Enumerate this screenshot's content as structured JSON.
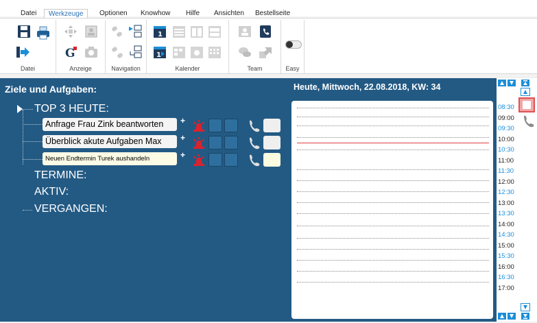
{
  "menu": {
    "tabs": [
      "Datei",
      "Werkzeuge",
      "Optionen",
      "Knowhow",
      "Hilfe",
      "Ansichten",
      "Bestellseite"
    ],
    "active": "Werkzeuge"
  },
  "ribbon": {
    "groups": [
      "Datei",
      "Anzeige",
      "Navigation",
      "Kalender",
      "Team",
      "Easy"
    ]
  },
  "left": {
    "title": "Ziele und Aufgaben:",
    "sections": {
      "top3": "TOP 3 HEUTE:",
      "termine": "TERMINE:",
      "aktiv": "AKTIV:",
      "vergangen": "VERGANGEN:"
    },
    "tasks": [
      "Anfrage Frau Zink beantworten",
      "Überblick akute Aufgaben Max",
      "Neuen Endtermin Turek aushandeln"
    ],
    "plus": "+"
  },
  "right": {
    "title": "Heute, Mittwoch, 22.08.2018, KW: 34"
  },
  "times": [
    "08:30",
    "09:00",
    "09:30",
    "10:00",
    "10:30",
    "11:00",
    "11:30",
    "12:00",
    "12:30",
    "13:00",
    "13:30",
    "14:00",
    "14:30",
    "15:00",
    "15:30",
    "16:00",
    "16:30",
    "17:00"
  ],
  "colors": {
    "panel": "#235a84",
    "accent": "#1c8ed8",
    "now_line": "#e04040",
    "alarm": "#d9232d"
  }
}
